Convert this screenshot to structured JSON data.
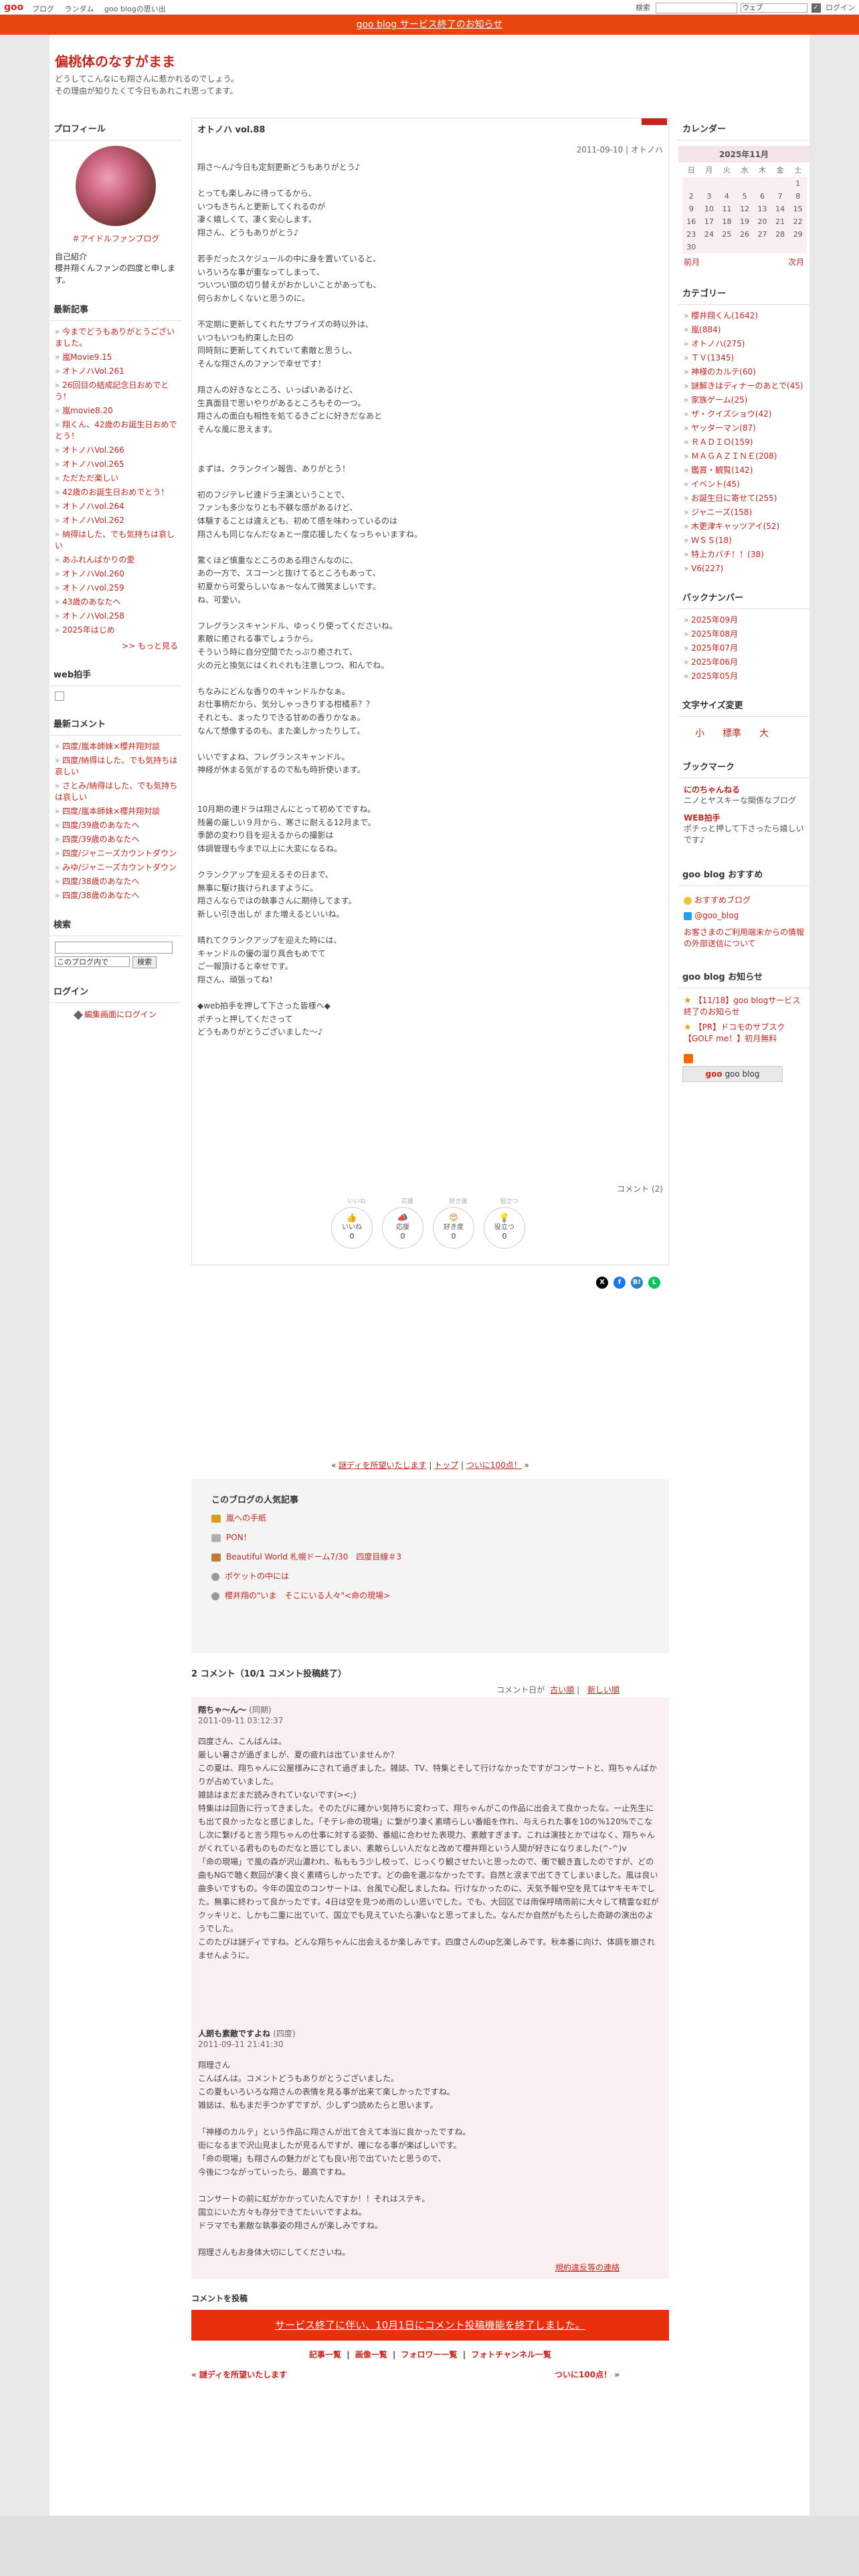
{
  "topbar": {
    "logo": "goo",
    "links": [
      "ブログ",
      "ランダム",
      "goo blogの思い出"
    ],
    "search_label": "検索",
    "search_scope": "ウェブ",
    "login": "ログイン"
  },
  "notice": "goo blog サービス終了のお知らせ",
  "blog": {
    "title": "偏桃体のなすがまま",
    "description": "どうしてこんなにも翔さんに惹かれるのでしょう。\nその理由が知りたくて今日もあれこれ思ってます。"
  },
  "left": {
    "profile_h": "プロフィール",
    "user_link": "＃アイドルファンブログ",
    "intro_h": "自己紹介",
    "intro": "櫻井翔くんファンの四度と申します。",
    "recent_h": "最新記事",
    "recent": [
      "今までどうもありがとうございました。",
      "嵐Movie9.15",
      "オトノハVol.261",
      "26回目の結成記念日おめでとう！",
      "嵐movie8.20",
      "翔くん、42歳のお誕生日おめでとう！",
      "オトノハVol.266",
      "オトノハvol.265",
      "ただただ楽しい",
      "42歳のお誕生日おめでとう！",
      "オトノハvol.264",
      "オトノハVol.262",
      "納得はした、でも気持ちは哀しい",
      "あふれんばかりの愛",
      "オトノハVol.260",
      "オトノハvol.259",
      "43歳のあなたへ",
      "オトノハVol.258",
      "2025年はじめ"
    ],
    "more": ">> もっと見る",
    "web_h": "web拍手",
    "comments_h": "最新コメント",
    "comments": [
      "四度/嵐本師妹×櫻井翔対談",
      "四度/納得はした、でも気持ちは哀しい",
      "さとみ/納得はした、でも気持ちは哀しい",
      "四度/嵐本師妹×櫻井翔対談",
      "四度/39歳のあなたへ",
      "四度/39歳のあなたへ",
      "四度/ジャニーズカウントダウン",
      "みゆ/ジャニーズカウントダウン",
      "四度/38歳のあなたへ",
      "四度/38歳のあなたへ"
    ],
    "search_h": "検索",
    "search_scope": "このブログ内で",
    "search_btn": "検索",
    "login_h": "ログイン",
    "edit_link": "編集画面にログイン"
  },
  "post": {
    "title": "オトノハ vol.88",
    "meta": "2011-09-10 | オトノハ",
    "body": "翔さ〜ん♪今日も定刻更新どうもありがとう♪\n\nとっても楽しみに待ってるから、\nいつもきちんと更新してくれるのが\n凄く嬉しくて、凄く安心します。\n翔さん、どうもありがとう♪\n\n若手だったスケジュールの中に身を置いていると、\nいろいろな事が重なってしまって、\nついつい頭の切り替えがおかしいことがあっても、\n何らおかしくないと思うのに。\n\n不定期に更新してくれたサプライズの時以外は、\nいつもいつも約束した日の\n同時刻に更新してくれていて素敵と思うし、\nそんな翔さんのファンで幸せです！\n\n翔さんの好きなところ、いっぱいあるけど、\n生真面目で思いやりがあるところもその一つ。\n翔さんの面白も相性を処てるきごとに好きだなあと\nそんな風に思えます。\n\n\nまずは、クランクイン報告、ありがとう！\n\n初のフジテレビ連ドラ主演ということで、\nファンも多少なりとも不躾な感があるけど、\n体験することは違えども、初めて感を味わっているのは\n翔さんも同じなんだなぁと一度応援したくなっちゃいますね。\n\n驚くほど慎重なところのある翔さんなのに、\nあの一方で、スコーンと抜けてるところもあって、\n初夏から可愛らしいなぁ〜なんて微笑ましいです。\nね、可愛い。\n\nフレグランスキャンドル、ゆっくり使ってくださいね。\n素敵に癒される事でしょうから。\nそういう時に自分空間でたっぷり癒されて、\n火の元と換気にはくれぐれも注意しつつ、和んでね。\n\nちなみにどんな香りのキャンドルかなぁ。\nお仕事柄だから、気分しゃっきりする柑橘系？？\nそれとも、まったりできる甘めの香りかなぁ。\nなんて想像するのも、また楽しかったりして。\n\nいいですよね、フレグランスキャンドル。\n神経が休まる気がするので私も時折使います。\n\n\n10月期の連ドラは翔さんにとって初めてですね。\n残暑の厳しい９月から、寒さに耐える12月まで。\n季節の変わり目を迎えるからの撮影は\n体調管理も今まで以上に大変になるね。\n\nクランクアップを迎えるその日まで、\n無事に駆け抜けられますように。\n翔さんならではの執事さんに期待してます。\n新しい引き出しが また増えるといいね。\n\n晴れてクランクアップを迎えた時には、\nキャンドルの優の溜り具合もめでて\nご一報頂けると幸せです。\n翔さん、頑張ってね！\n\n◆web拍手を押して下さった皆様へ◆\nポチっと押してくださって\nどうもありがとうございました〜♪",
    "comment_count": "コメント (2)",
    "reactions_top": [
      "いいね",
      "応援",
      "好き度",
      "役立つ"
    ],
    "reactions": [
      {
        "label": "いいね",
        "count": "0"
      },
      {
        "label": "応援",
        "count": "0"
      },
      {
        "label": "好き度",
        "count": "0"
      },
      {
        "label": "役立つ",
        "count": "0"
      }
    ],
    "share": [
      "X",
      "f",
      "B!",
      "L"
    ]
  },
  "right": {
    "calendar_h": "カレンダー",
    "month": "2025年11月",
    "dow": [
      "日",
      "月",
      "火",
      "水",
      "木",
      "金",
      "土"
    ],
    "weeks": [
      [
        "",
        "",
        "",
        "",
        "",
        "",
        "1"
      ],
      [
        "2",
        "3",
        "4",
        "5",
        "6",
        "7",
        "8"
      ],
      [
        "9",
        "10",
        "11",
        "12",
        "13",
        "14",
        "15"
      ],
      [
        "16",
        "17",
        "18",
        "19",
        "20",
        "21",
        "22"
      ],
      [
        "23",
        "24",
        "25",
        "26",
        "27",
        "28",
        "29"
      ],
      [
        "30",
        "",
        "",
        "",
        "",
        "",
        ""
      ]
    ],
    "prev": "前月",
    "next": "次月",
    "category_h": "カテゴリー",
    "categories": [
      "櫻井翔くん(1642)",
      "嵐(884)",
      "オトノハ(275)",
      "ＴＶ(1345)",
      "神様のカルテ(60)",
      "謎解きはディナーのあとで(45)",
      "家族ゲーム(25)",
      "ザ・クイズショウ(42)",
      "ヤッターマン(87)",
      "ＲＡＤＩＯ(159)",
      "ＭＡＧＡＺＩＮＥ(208)",
      "鑑賞・観覧(142)",
      "イベント(45)",
      "お誕生日に寄せて(255)",
      "ジャニーズ(158)",
      "木更津キャッツアイ(52)",
      "ＷＳＳ(18)",
      "特上カバチ！！(38)",
      "V6(227)"
    ],
    "backnumber_h": "バックナンバー",
    "backnumbers": [
      "2025年09月",
      "2025年08月",
      "2025年07月",
      "2025年06月",
      "2025年05月"
    ],
    "textsize_h": "文字サイズ変更",
    "textsize": [
      "小",
      "標準",
      "大"
    ],
    "bookmark_h": "ブックマーク",
    "bookmarks": [
      {
        "title": "にのちゃんねる",
        "desc": "ニノとヤスキーな関係なブログ"
      },
      {
        "title": "WEB拍手",
        "desc": "ポチっと押して下さったら嬉しいです♪"
      }
    ],
    "rec_h": "goo blog おすすめ",
    "rec": [
      "おすすめブログ",
      "@goo_blog"
    ],
    "ad_link": "お客さまのご利用端末からの情報の外部送信について",
    "news_h": "goo blog お知らせ",
    "news": [
      "【11/18】goo blogサービス終了のお知らせ",
      "【PR】ドコモのサブスク【GOLF me！】初月無料"
    ],
    "goo_btn": "goo blog",
    "goo_btn_mark": "goo"
  },
  "links_under": {
    "prev": "謎ディを所望いたします",
    "top": "トップ",
    "next": "ついに100点！"
  },
  "popular": {
    "h": "このブログの人気記事",
    "items": [
      "嵐への手紙",
      "PON！",
      "Beautiful World 札幌ドーム7/30　四度目線＃3",
      "ポケットの中には",
      "櫻井翔の\"いま　そこにいる人々\"<命の現場>"
    ]
  },
  "comments": {
    "h": "2 コメント（10/1 コメント投稿終了）",
    "sort_label": "コメント日が",
    "sort_old": "古い順",
    "sort_new": "新しい順",
    "items": [
      {
        "author": "翔ちゃ〜ん〜",
        "from": "(同期)",
        "date": "2011-09-11 03:12:37",
        "body": "四度さん、こんばんは。\n厳しい暑さが過ぎましが、夏の疲れは出ていませんか？\nこの夏は、翔ちゃんに公屋様みにされて過ぎました。雑誌、TV、特集とそして行けなかったですがコンサートと、翔ちゃんばかりが占めていました。\n雑誌はまだまだ読みきれていないです(><;)\n特集はは回告に行ってきました。そのたびに確かい気持ちに変わって、翔ちゃんがこの作品に出会えて良かったな。一止先生にも出て良かったなと感じました。「そテレ命の現場」に繋がり凄く素晴らしい番組を作れ、与えられた事を10の%120%でこなし次に繋げると言う翔ちゃんの仕事に対する姿勢、番組に合わせた表現力、素敵すぎます。これは演技とかではなく、翔ちゃんがくれている君ものものだなと感じてしまい、素敵らしい人だなと改めて櫻井翔という人間が好きになりました(^-^)v\n「命の現場」で風の森が沢山濃われ、私ももう少し校って、じっくり観させたいと思ったので、衝で観き直したのですが、どの曲もNGで聴く数回が凄く良く素晴らしかったです。どの曲を選ぶなかったです。自然と涙まで出てきてしまいました。風は良い曲多いですもの。今年の国立のコンサートは、台風で心配しましたね。行けなかったのに、天気予報や空を見てはヤキモキでした。無事に終わって良かったです。4日は空を見つめ雨のしい思いでした。でも、大回区では雨保呼晴雨前に大々して精霊な虹がクッキリと、しかも二重に出ていて、国立でも見えていたら凄いなと思ってました。なんだか自然がもたらした奇跡の演出のようでした。\nこのたびは謎ディですね。どんな翔ちゃんに出会えるか楽しみです。四度さんのup乞楽しみです。秋本番に向け、体調を崩されませんように。"
      },
      {
        "author": "人朗も素敵ですよね",
        "from": "(四度)",
        "date": "2011-09-11 21:41:30",
        "body": "翔理さん\nこんばんは。コメントどうもありがとうございました。\nこの夏もいろいろな翔さんの表情を見る事が出来て楽しかったですね。\n雑誌は、私もまだ手つかずですが、少しずつ読めたらと思います。\n\n「神様のカルテ」という作品に翔さんが出て合えて本当に良かったですね。\n街になるまで沢山見ましたが見るんですが、確になる事が楽ばしいです。\n「命の現場」も翔さんの魅力がとても良い形で出ていたと思うので、\n今後につながっていったら、最高ですね。\n\nコンサートの前に虹がかかっていたんですか！！それはステキ。\n国立にいた方々も存分できてたいいですよね。\nドラマでも素敵な執事姿の翔さんが楽しみですね。\n\n翔理さんもお身体大切にしてくださいね。"
      }
    ],
    "terms": "規約違反等の連絡",
    "post_h": "コメントを投稿",
    "end_banner": "サービス終了に伴い、10月1日にコメント投稿機能を終了しました。"
  },
  "nav": {
    "links": [
      "記事一覧",
      "画像一覧",
      "フォロワー一覧",
      "フォトチャンネル一覧"
    ],
    "prev": "« 謎ディを所望いたします",
    "next": "ついに100点！ »"
  }
}
